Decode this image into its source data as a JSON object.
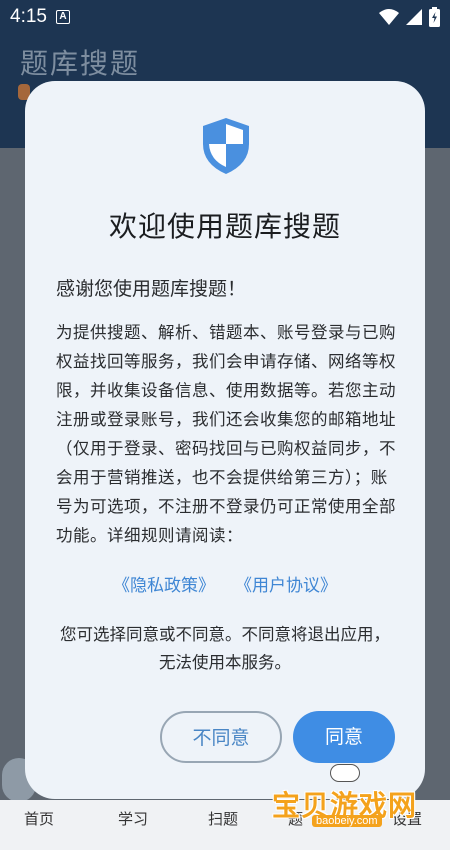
{
  "status_bar": {
    "time": "4:15",
    "notif_letter": "A"
  },
  "background_app": {
    "title": "题库搜题",
    "nav": [
      "首页",
      "学习",
      "扫题",
      "题",
      "设置"
    ]
  },
  "dialog": {
    "title": "欢迎使用题库搜题",
    "greeting": "感谢您使用题库搜题！",
    "body": "为提供搜题、解析、错题本、账号登录与已购权益找回等服务，我们会申请存储、网络等权限，并收集设备信息、使用数据等。若您主动注册或登录账号，我们还会收集您的邮箱地址（仅用于登录、密码找回与已购权益同步，不会用于营销推送，也不会提供给第三方）；账号为可选项，不注册不登录仍可正常使用全部功能。详细规则请阅读：",
    "privacy_link": "《隐私政策》",
    "terms_link": "《用户协议》",
    "note": "您可选择同意或不同意。不同意将退出应用，无法使用本服务。",
    "disagree": "不同意",
    "agree": "同意"
  },
  "watermark": {
    "cn": "宝贝游戏网",
    "en": "baobeiy.com"
  },
  "colors": {
    "accent": "#3f8de4",
    "header": "#1d3552",
    "dialog_bg": "#eef3f9"
  },
  "icons": [
    "wifi-icon",
    "signal-icon",
    "battery-icon",
    "shield-icon"
  ]
}
